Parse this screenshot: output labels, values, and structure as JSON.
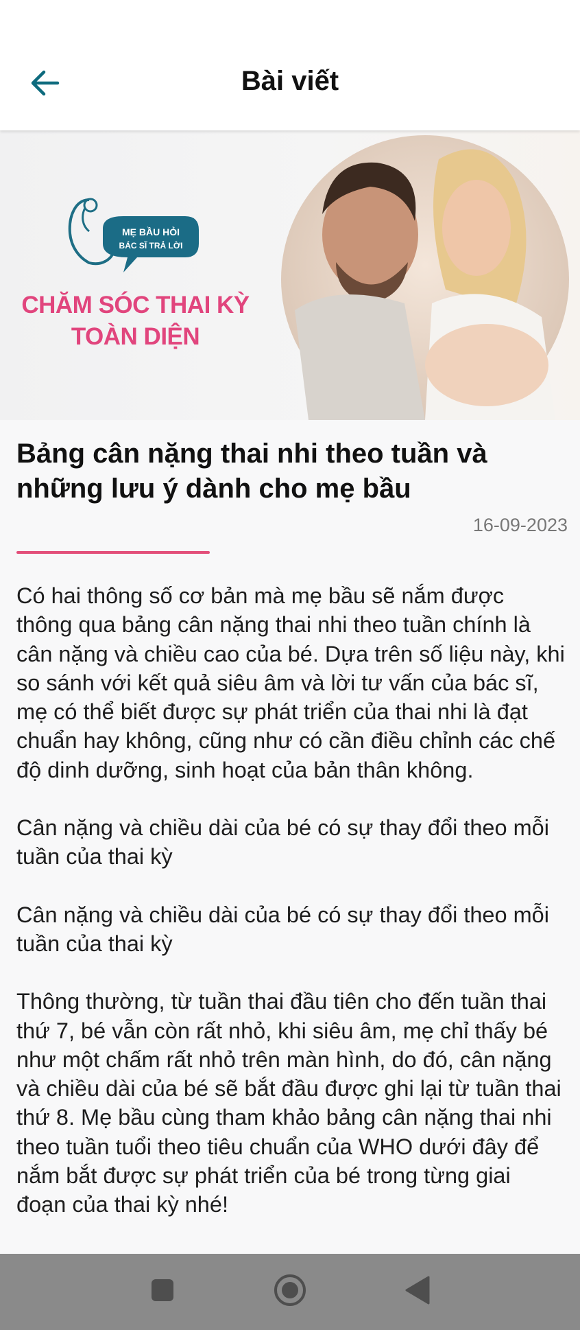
{
  "app_bar": {
    "title": "Bài viết",
    "back_icon": "arrow-left-icon"
  },
  "banner": {
    "logo_line1": "MẸ BẦU HỎI",
    "logo_line2": "BÁC SĨ TRẢ LỜI",
    "headline_line1": "CHĂM SÓC THAI KỲ",
    "headline_line2": "TOÀN DIỆN",
    "headline_color": "#e1457d"
  },
  "article": {
    "title": "Bảng cân nặng thai nhi theo tuần và những lưu ý dành cho mẹ bầu",
    "date": "16-09-2023",
    "accent_color": "#e34f7a",
    "paragraphs": [
      "Có hai thông số cơ bản mà mẹ bầu sẽ nắm được thông qua bảng cân nặng thai nhi theo tuần chính là cân nặng và chiều cao của bé. Dựa trên số liệu này, khi so sánh với kết quả siêu âm và lời tư vấn của bác sĩ, mẹ có thể biết được sự phát triển của thai nhi là đạt chuẩn hay không, cũng như có cần điều chỉnh các chế độ dinh dưỡng, sinh hoạt của bản thân không.",
      "Cân nặng và chiều dài của bé có sự thay đổi theo mỗi tuần của thai kỳ",
      "Cân nặng và chiều dài của bé có sự thay đổi theo mỗi tuần của thai kỳ",
      "Thông thường, từ tuần thai đầu tiên cho đến tuần thai thứ 7, bé vẫn còn rất nhỏ, khi siêu âm, mẹ chỉ thấy bé như một chấm rất nhỏ trên màn hình, do đó, cân nặng và chiều dài của bé sẽ bắt đầu được ghi lại từ tuần thai thứ 8. Mẹ bầu cùng tham khảo bảng cân nặng thai nhi theo tuần tuổi theo tiêu chuẩn của WHO dưới đây để nắm bắt được sự phát triển của bé trong từng giai đoạn của thai kỳ nhé!"
    ]
  },
  "nav_bar": {
    "recents_icon": "square-icon",
    "home_icon": "circle-home-icon",
    "back_icon": "triangle-back-icon"
  }
}
